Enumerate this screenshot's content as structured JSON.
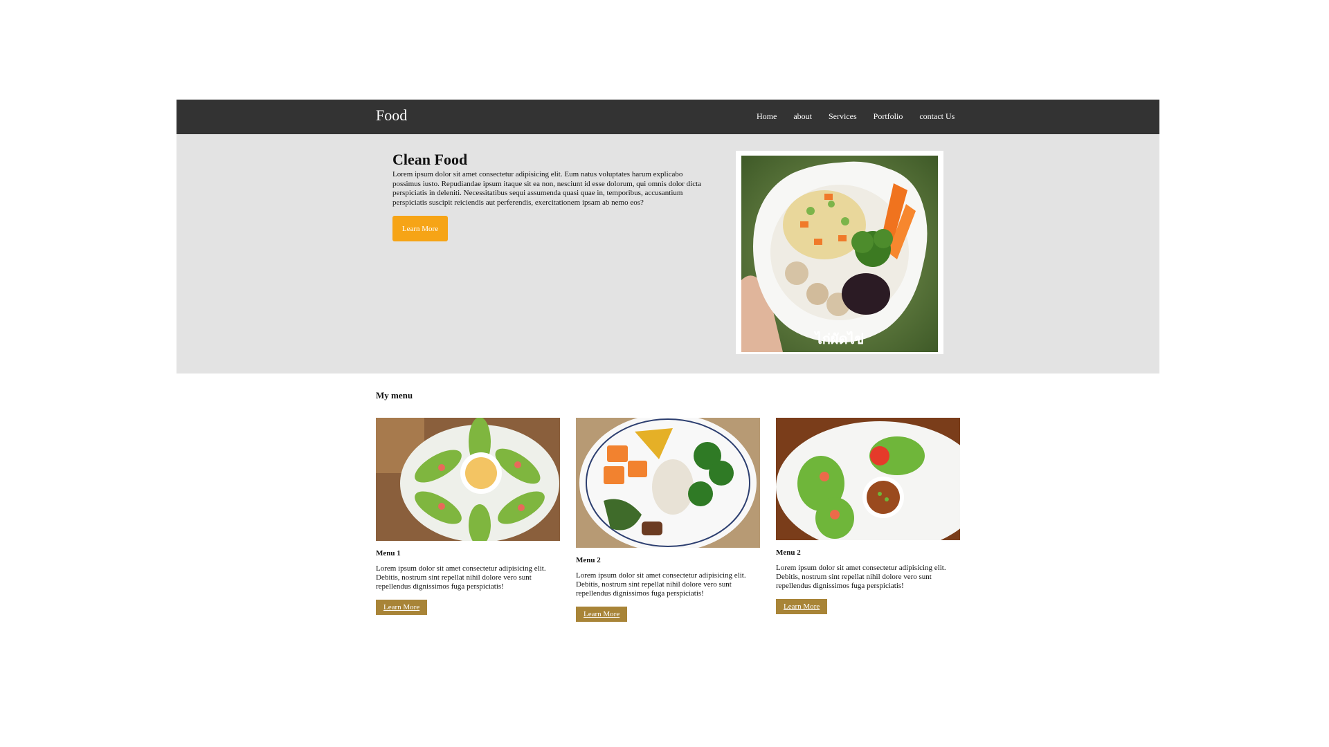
{
  "nav": {
    "brand": "Food",
    "links": [
      "Home",
      "about",
      "Services",
      "Portfolio",
      "contact Us"
    ]
  },
  "hero": {
    "title": "Clean Food",
    "text": "Lorem ipsum dolor sit amet consectetur adipisicing elit. Eum natus voluptates harum explicabo possimus iusto. Repudiandae ipsum itaque sit ea non, nesciunt id esse dolorum, qui omnis dolor dicta perspiciatis in deleniti. Necessitatibus sequi assumenda quasi quae in, temporibus, accusantium perspiciatis suscipit reiciendis aut perferendis, exercitationem ipsam ab nemo eos?",
    "button_label": "Learn More",
    "image_watermark": "ไก่ผัดไข่"
  },
  "menu": {
    "heading": "My menu",
    "cards": [
      {
        "title": "Menu 1",
        "text": "Lorem ipsum dolor sit amet consectetur adipisicing elit. Debitis, nostrum sint repellat nihil dolore vero sunt repellendus dignissimos fuga perspiciatis!",
        "button_label": "Learn More"
      },
      {
        "title": "Menu 2",
        "text": "Lorem ipsum dolor sit amet consectetur adipisicing elit. Debitis, nostrum sint repellat nihil dolore vero sunt repellendus dignissimos fuga perspiciatis!",
        "button_label": "Learn More"
      },
      {
        "title": "Menu 2",
        "text": "Lorem ipsum dolor sit amet consectetur adipisicing elit. Debitis, nostrum sint repellat nihil dolore vero sunt repellendus dignissimos fuga perspiciatis!",
        "button_label": "Learn More"
      }
    ]
  },
  "colors": {
    "navbar": "#333333",
    "hero_background": "#e3e3e3",
    "hero_button": "#f6a416",
    "card_button": "#a88437"
  }
}
